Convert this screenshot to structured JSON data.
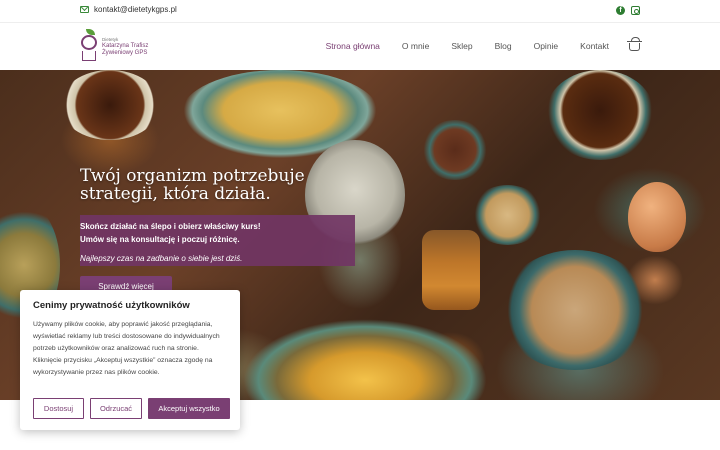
{
  "topbar": {
    "email": "kontakt@dietetykgps.pl",
    "icons": [
      "mail-icon",
      "facebook-icon",
      "instagram-icon"
    ]
  },
  "logo": {
    "small": "Dietetyk",
    "name": "Katarzyna Trafisz",
    "tagline": "Żywieniowy GPS"
  },
  "nav": {
    "items": [
      "Strona główna",
      "O mnie",
      "Sklep",
      "Blog",
      "Opinie",
      "Kontakt"
    ],
    "active_index": 0,
    "cart_icon": "basket-icon"
  },
  "hero": {
    "title": "Twój organizm potrzebuje strategii, która działa.",
    "line1": "Skończ działać na ślepo i obierz właściwy kurs!",
    "line2": "Umów się na konsultację i poczuj różnicę.",
    "note": "Najlepszy czas na zadbanie o siebie jest dziś.",
    "cta": "Sprawdź więcej"
  },
  "cookie": {
    "title": "Cenimy prywatność użytkowników",
    "body": "Używamy plików cookie, aby poprawić jakość przeglądania, wyświetlać reklamy lub treści dostosowane do indywidualnych potrzeb użytkowników oraz analizować ruch na stronie. Kliknięcie przycisku „Akceptuj wszystkie” oznacza zgodę na wykorzystywanie przez nas plików cookie.",
    "customize": "Dostosuj",
    "reject": "Odrzucać",
    "accept": "Akceptuj wszystko"
  },
  "colors": {
    "brand": "#7a3f73",
    "accent_green": "#2e7d32"
  }
}
